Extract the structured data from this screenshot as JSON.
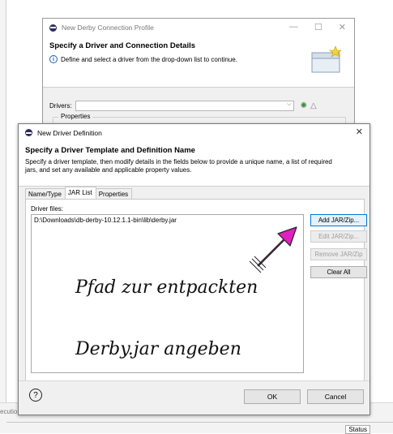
{
  "bg_dialog": {
    "title": "New Derby Connection Profile",
    "heading": "Specify a Driver and Connection Details",
    "info": "Define and select a driver from the drop-down list to continue.",
    "drivers_label": "Drivers:",
    "properties_label": "Properties"
  },
  "dialog": {
    "title": "New Driver Definition",
    "heading": "Specify a Driver Template and Definition Name",
    "description": "Specify a driver template, then modify details in the fields below to provide a unique name, a list of required jars, and set any available and applicable property values.",
    "tabs": [
      {
        "label": "Name/Type"
      },
      {
        "label": "JAR List"
      },
      {
        "label": "Properties"
      }
    ],
    "active_tab": "JAR List",
    "driver_files_label": "Driver files:",
    "driver_files": [
      "D:\\Downloads\\db-derby-10.12.1.1-bin\\lib\\derby.jar"
    ],
    "buttons": {
      "add": "Add JAR/Zip...",
      "edit": "Edit JAR/Zip...",
      "remove": "Remove JAR/Zip",
      "clear": "Clear All"
    },
    "ok": "OK",
    "cancel": "Cancel",
    "help": "?"
  },
  "annotation": {
    "line1": "Pfad zur entpackten",
    "line2": "Derby.jar angeben",
    "arrow_color": "#e020c0"
  },
  "ide": {
    "exec_text": "ecutio",
    "status": "Status"
  }
}
